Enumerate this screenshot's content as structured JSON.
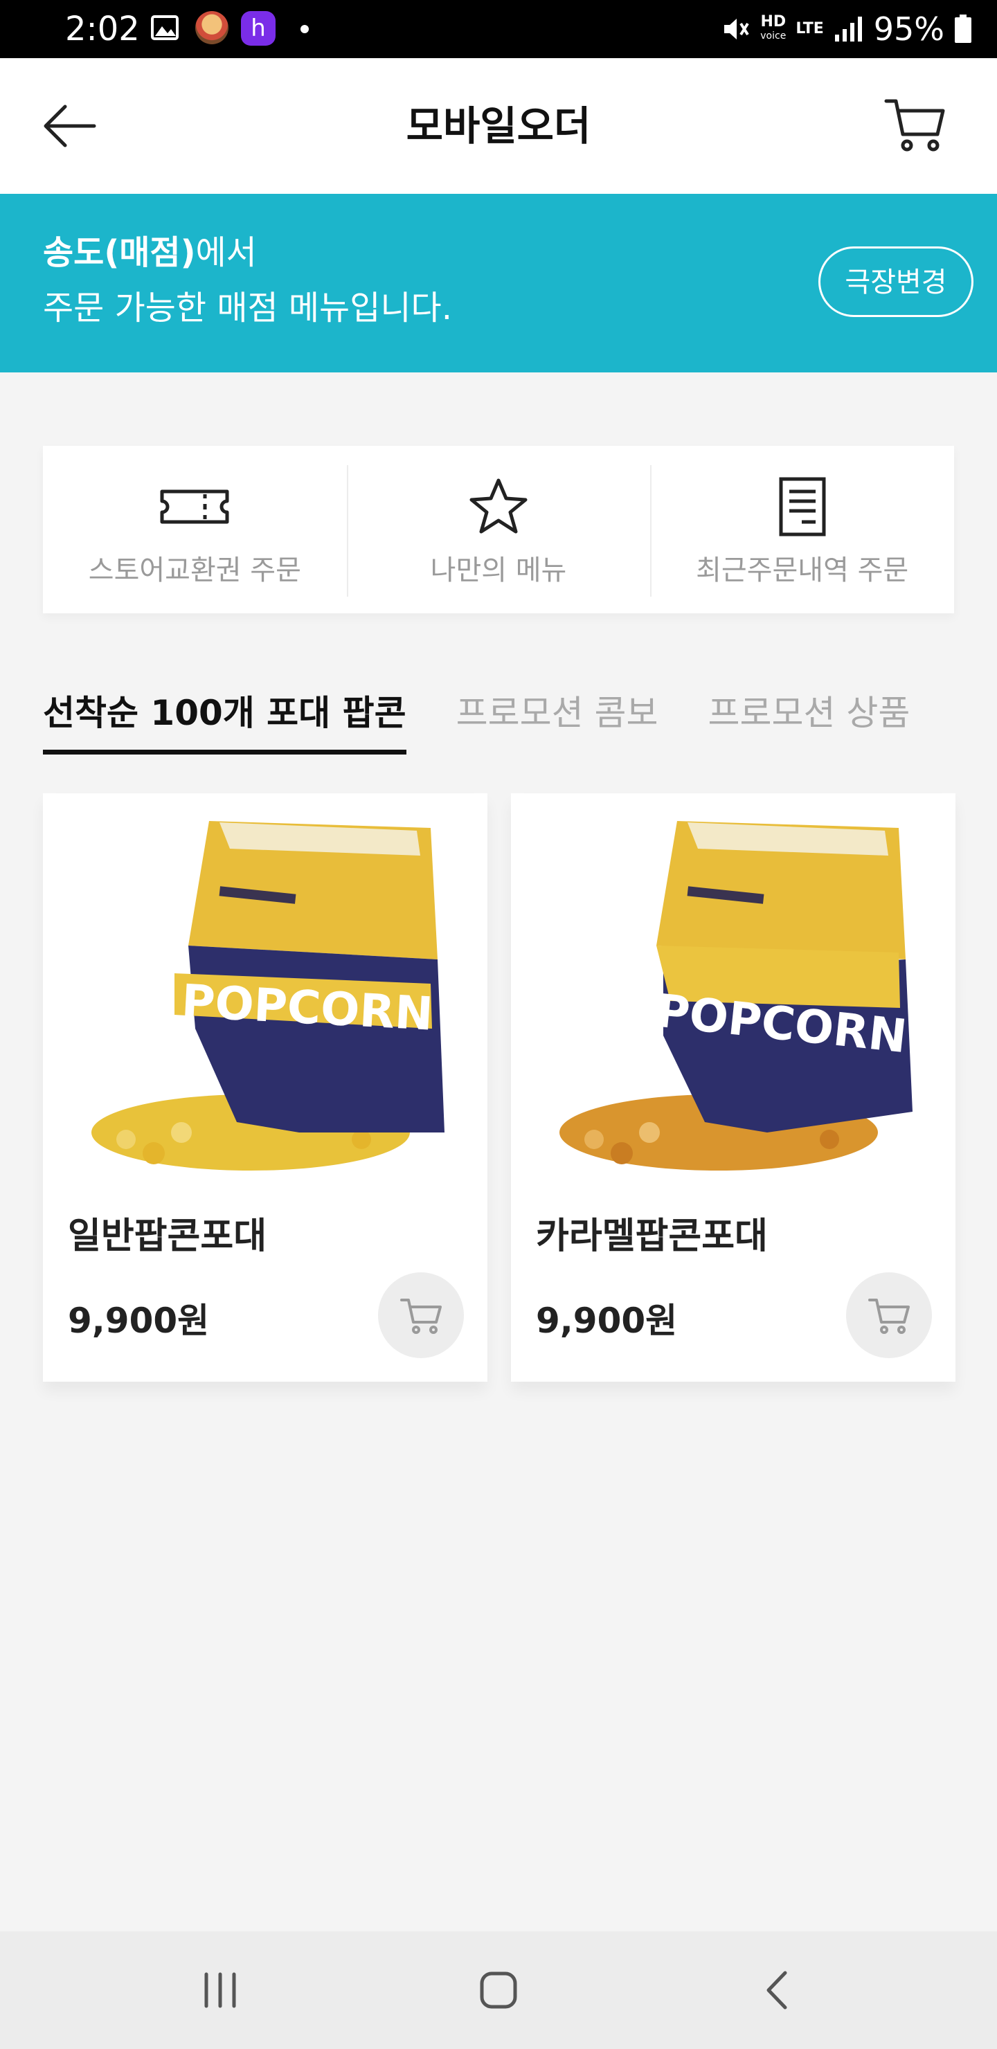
{
  "status_bar": {
    "time": "2:02",
    "hd_label": "HD",
    "voice_label": "voice",
    "lte_label": "LTE",
    "battery": "95%",
    "app_icon_letter": "h"
  },
  "header": {
    "title": "모바일오더"
  },
  "banner": {
    "store_name": "송도(매점)",
    "line1_suffix": "에서",
    "line2": "주문 가능한 매점 메뉴입니다.",
    "change_button": "극장변경",
    "color": "#1cb5cb"
  },
  "quick_menu": [
    {
      "label": "스토어교환권 주문",
      "icon": "ticket-icon"
    },
    {
      "label": "나만의 메뉴",
      "icon": "star-icon"
    },
    {
      "label": "최근주문내역 주문",
      "icon": "receipt-icon"
    }
  ],
  "tabs": [
    {
      "label": "선착순 100개 포대 팝콘",
      "active": true
    },
    {
      "label": "프로모션 콤보",
      "active": false
    },
    {
      "label": "프로모션 상품",
      "active": false
    }
  ],
  "products": [
    {
      "name": "일반팝콘포대",
      "price": "9,900원",
      "popcorn_color": "#e8c23a"
    },
    {
      "name": "카라멜팝콘포대",
      "price": "9,900원",
      "popcorn_color": "#d9952e"
    }
  ],
  "bag_text": "POPCORN"
}
